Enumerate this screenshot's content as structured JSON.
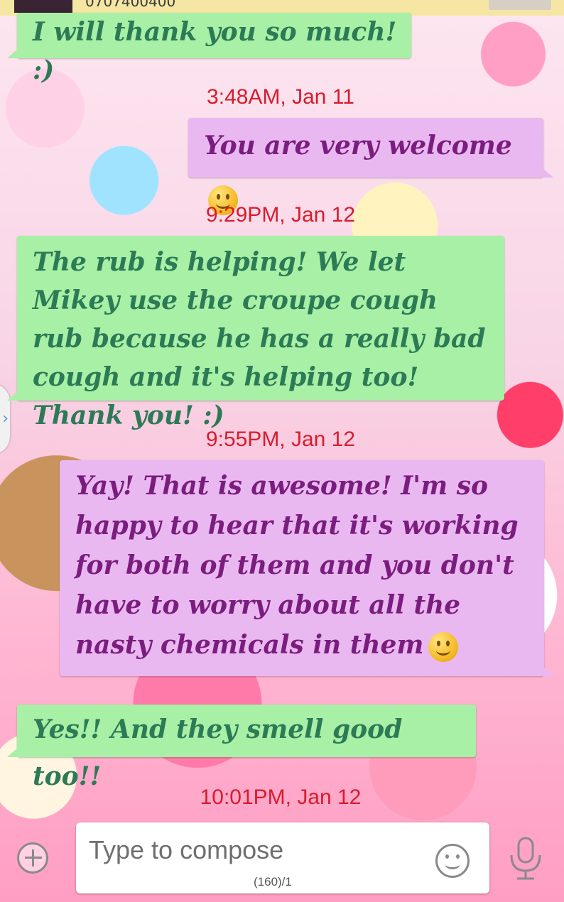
{
  "header": {
    "number_fragment": "0707400400"
  },
  "messages": [
    {
      "type": "in",
      "text": "I will thank you so much! :)"
    },
    {
      "type": "stamp",
      "text": "3:48AM, Jan 11"
    },
    {
      "type": "out",
      "text": "You are very welcome",
      "emoji": "smiley-emoji"
    },
    {
      "type": "stamp",
      "text": "9:29PM, Jan 12"
    },
    {
      "type": "in",
      "text": "The rub is helping! We let Mikey use the croupe cough rub because he has a really bad cough and it's helping too! Thank you! :)"
    },
    {
      "type": "stamp",
      "text": "9:55PM, Jan 12"
    },
    {
      "type": "out",
      "text": "Yay! That is awesome! I'm so happy to hear that it's working for both of them and you don't have to worry about all the nasty chemicals in them",
      "emoji": "smiley-emoji"
    },
    {
      "type": "in",
      "text": "Yes!! And they smell good too!!"
    },
    {
      "type": "stamp",
      "text": "10:01PM, Jan 12"
    }
  ],
  "composer": {
    "placeholder": "Type to compose",
    "counter": "(160)/1",
    "icons": [
      "add-icon",
      "emoji-icon",
      "microphone-icon"
    ]
  },
  "colors": {
    "incoming_bubble": "#a7f0a5",
    "incoming_text": "#2c7a56",
    "outgoing_bubble": "#eab8f0",
    "outgoing_text": "#7a1d7e",
    "timestamp": "#d81c2d"
  }
}
